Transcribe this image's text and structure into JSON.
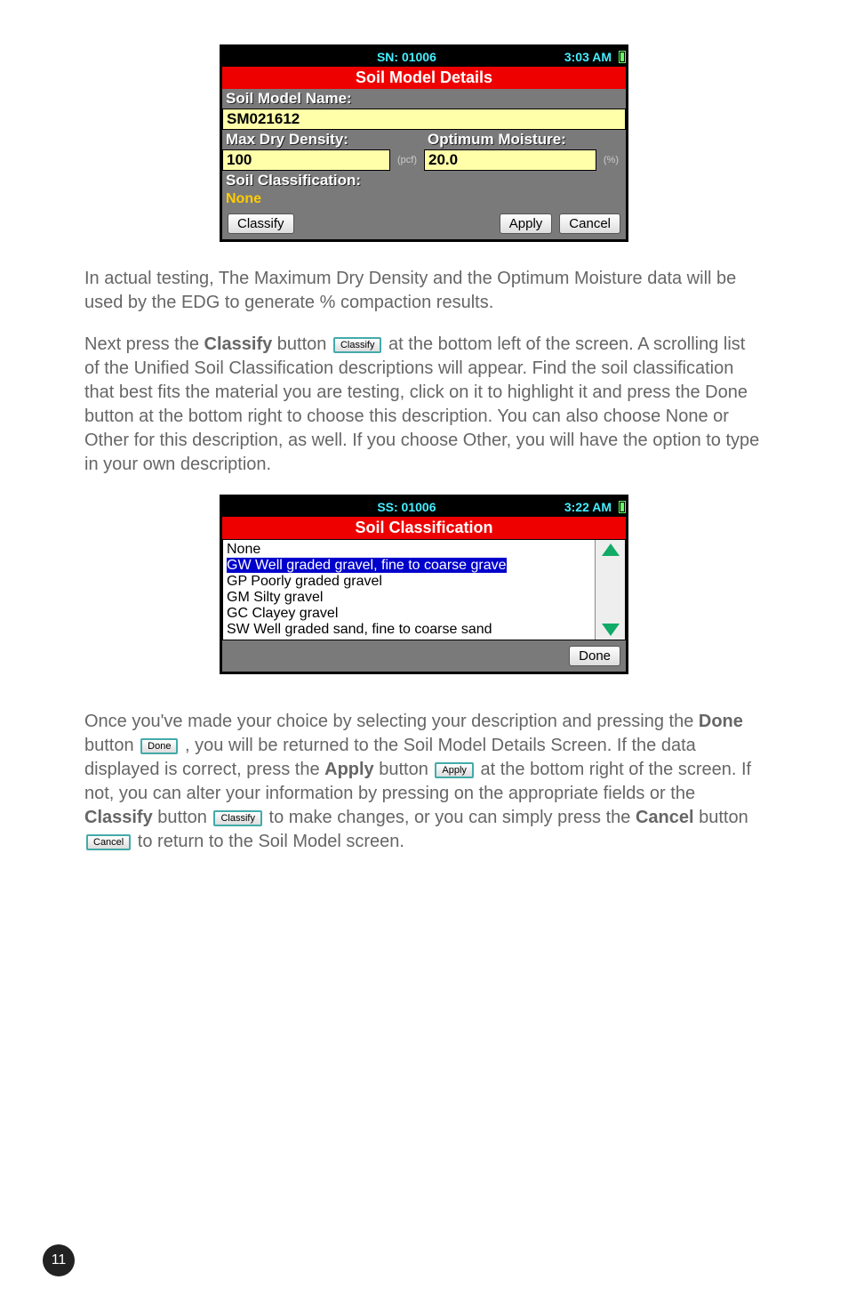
{
  "screen1": {
    "sn_label": "SN: 01006",
    "time": "3:03 AM",
    "title": "Soil Model Details",
    "name_label": "Soil Model Name:",
    "name_value": "SM021612",
    "density_label": "Max Dry Density:",
    "density_value": "100",
    "density_unit": "(pcf)",
    "moisture_label": "Optimum Moisture:",
    "moisture_value": "20.0",
    "moisture_unit": "(%)",
    "class_label": "Soil Classification:",
    "class_value": "None",
    "btn_classify": "Classify",
    "btn_apply": "Apply",
    "btn_cancel": "Cancel"
  },
  "para1": "In actual testing, The Maximum Dry Density and the Optimum Moisture data will be used by the EDG to generate % compaction results.",
  "para2a": "Next press the ",
  "para2boldA": "Classify",
  "para2b": " button ",
  "inline_classify": "Classify",
  "para2c": " at the bottom left of the screen. A scrolling list of the Unified Soil Classification descriptions will appear. Find the soil classification that best fits the material you are testing, click on it to highlight it and press the Done button at the bottom right to choose this description. You can also choose None or Other for this description, as well. If you choose Other, you will have the option to type in your own description.",
  "screen2": {
    "sn_label": "SS: 01006",
    "time": "3:22 AM",
    "title": "Soil Classification",
    "items": [
      "None",
      "GW Well graded gravel, fine to coarse grave",
      "GP Poorly graded gravel",
      "GM Silty gravel",
      "GC Clayey gravel",
      "SW Well graded sand, fine to coarse sand"
    ],
    "btn_done": "Done"
  },
  "para3a": "Once you've made your choice by selecting your description and pressing the ",
  "para3boldA": "Done",
  "para3b": " button ",
  "inline_done": "Done",
  "para3c": " , you will be returned to the Soil Model Details Screen. If the data displayed is correct, press the ",
  "para3boldB": "Apply",
  "para3d": " button ",
  "inline_apply": "Apply",
  "para3e": " at the bottom right of the screen. If not, you can alter your information by pressing on the appropriate fields or the ",
  "para3boldC": "Classify",
  "para3f": " button ",
  "inline_classify2": "Classify",
  "para3g": " to make changes, or you can simply press the ",
  "para3boldD": "Cancel",
  "para3h": " button ",
  "inline_cancel": "Cancel",
  "para3i": " to return to the Soil Model screen.",
  "page_num": "11"
}
